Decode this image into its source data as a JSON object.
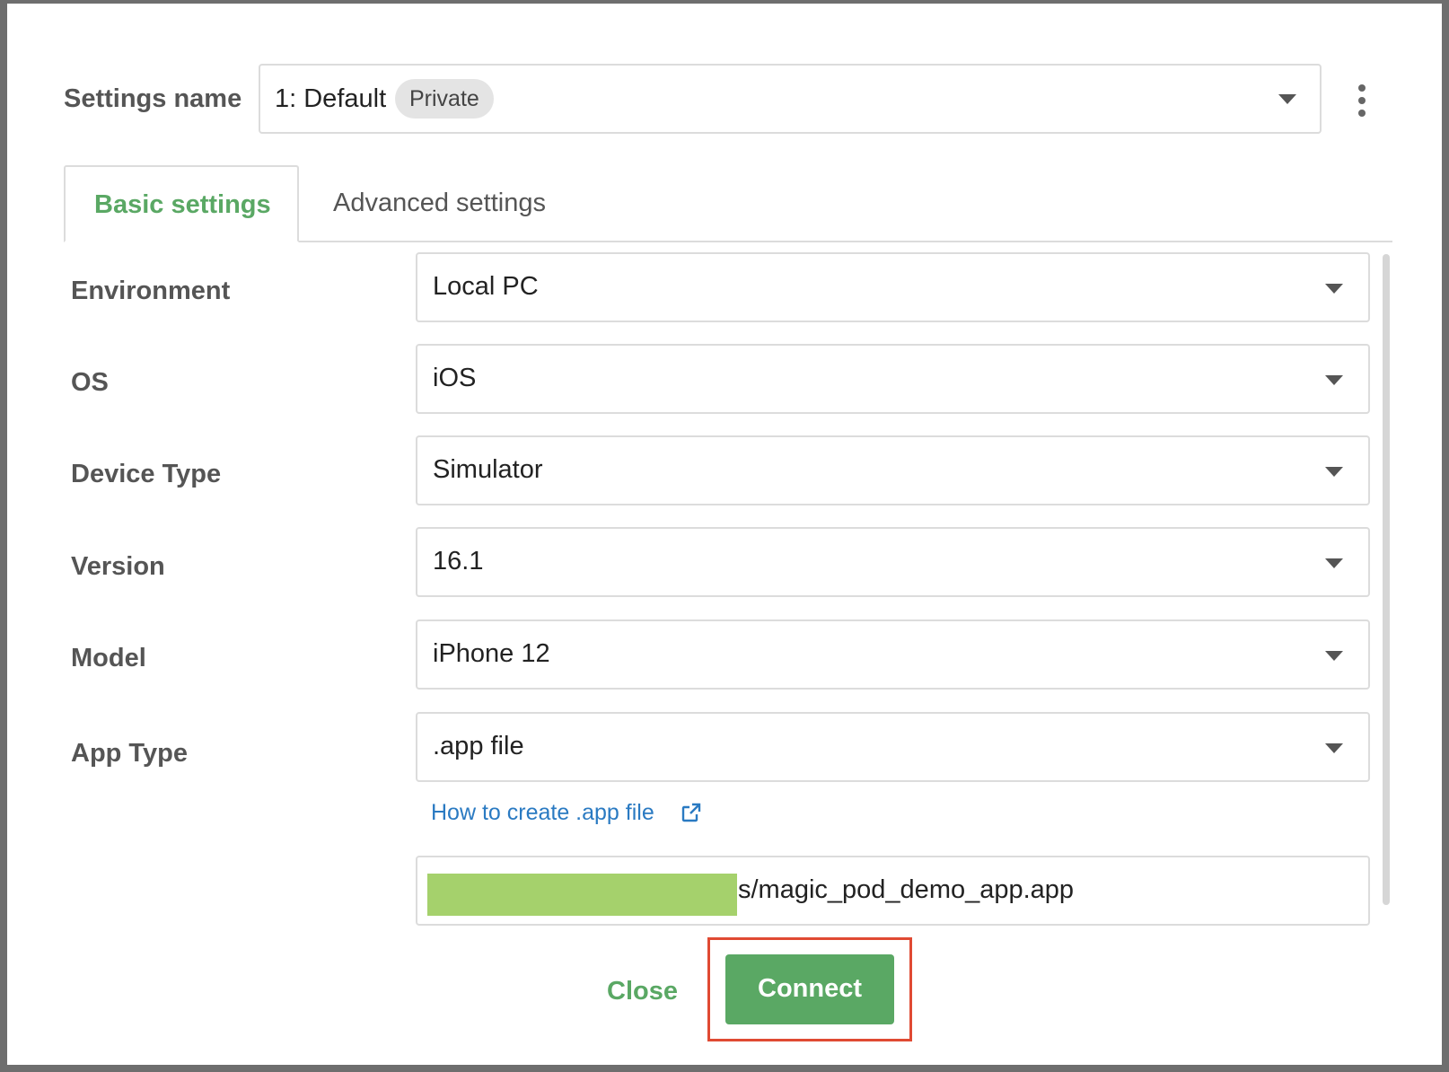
{
  "settings": {
    "label": "Settings name",
    "value": "1: Default",
    "badge": "Private"
  },
  "tabs": {
    "basic": "Basic settings",
    "advanced": "Advanced settings"
  },
  "form": {
    "environment": {
      "label": "Environment",
      "value": "Local PC"
    },
    "os": {
      "label": "OS",
      "value": "iOS"
    },
    "device_type": {
      "label": "Device Type",
      "value": "Simulator"
    },
    "version": {
      "label": "Version",
      "value": "16.1"
    },
    "model": {
      "label": "Model",
      "value": "iPhone 12"
    },
    "app_type": {
      "label": "App Type",
      "value": ".app file"
    }
  },
  "help_link": "How to create .app file",
  "app_path": "s/magic_pod_demo_app.app",
  "buttons": {
    "close": "Close",
    "connect": "Connect"
  },
  "colors": {
    "accent_green": "#5aa864",
    "link_blue": "#2a7ac2",
    "highlight_red": "#e04a33",
    "redaction_green": "#a5d16c"
  },
  "icons": {
    "settings_select": "chevron-down-icon",
    "kebab": "more-vertical-icon",
    "help_link": "external-link-icon"
  }
}
